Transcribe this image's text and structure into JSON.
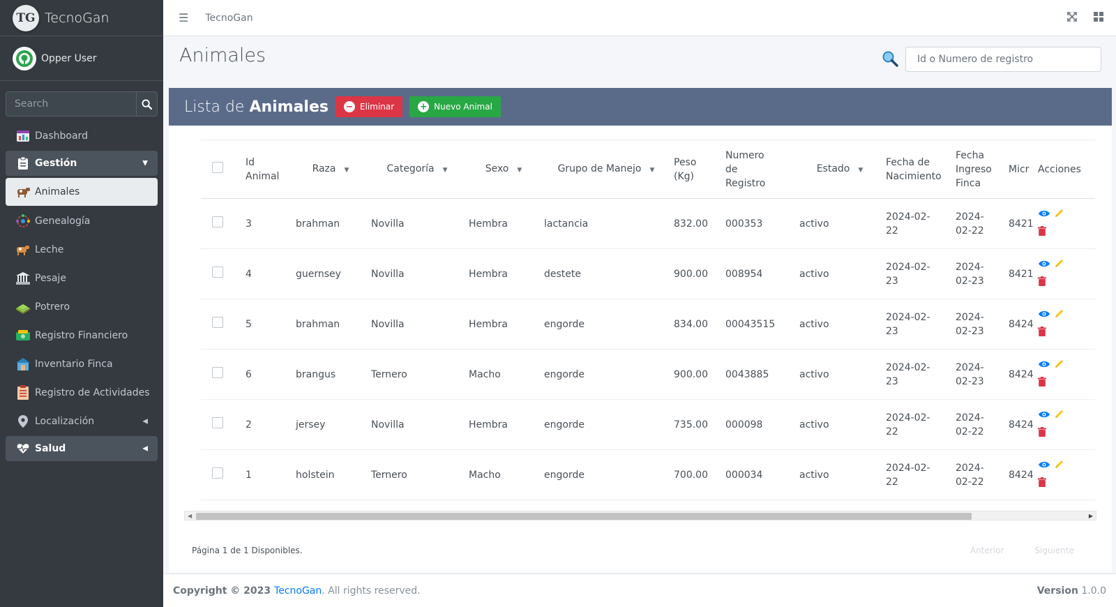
{
  "brand": {
    "logo_text": "TG",
    "name": "TecnoGan"
  },
  "user": {
    "name": "Opper User"
  },
  "sidebar": {
    "search_placeholder": "Search",
    "items": [
      {
        "label": "Dashboard",
        "icon": "dashboard-icon"
      },
      {
        "label": "Gestión",
        "icon": "clipboard-icon"
      },
      {
        "label": "Animales",
        "icon": "cattle-icon"
      },
      {
        "label": "Genealogía",
        "icon": "genealogy-icon"
      },
      {
        "label": "Leche",
        "icon": "milk-icon"
      },
      {
        "label": "Pesaje",
        "icon": "scale-icon"
      },
      {
        "label": "Potrero",
        "icon": "pasture-icon"
      },
      {
        "label": "Registro Financiero",
        "icon": "money-icon"
      },
      {
        "label": "Inventario Finca",
        "icon": "warehouse-icon"
      },
      {
        "label": "Registro de Actividades",
        "icon": "activity-list-icon"
      },
      {
        "label": "Localización",
        "icon": "map-marker-icon"
      },
      {
        "label": "Salud",
        "icon": "heartbeat-icon"
      }
    ]
  },
  "topbar": {
    "title": "TecnoGan"
  },
  "page": {
    "title": "Animales",
    "search_placeholder": "Id o Numero de registro"
  },
  "card": {
    "title_prefix": "Lista de ",
    "title_bold": "Animales",
    "delete_label": "Eliminar",
    "new_label": "Nuevo Animal"
  },
  "table": {
    "headers": {
      "id": "Id Animal",
      "raza": "Raza",
      "categoria": "Categoría",
      "sexo": "Sexo",
      "grupo": "Grupo de Manejo",
      "peso": "Peso (Kg)",
      "numero": "Numero de Registro",
      "estado": "Estado",
      "fecha_nac": "Fecha de Nacimiento",
      "fecha_ingreso": "Fecha Ingreso Finca",
      "micro": "Micr",
      "acciones": "Acciones"
    },
    "rows": [
      {
        "id": "3",
        "raza": "brahman",
        "categoria": "Novilla",
        "sexo": "Hembra",
        "grupo": "lactancia",
        "peso": "832.00",
        "numero": "000353",
        "estado": "activo",
        "fecha_nac_1": "2024-02-",
        "fecha_nac_2": "22",
        "fecha_ing_1": "2024-",
        "fecha_ing_2": "02-22",
        "micro": "8421"
      },
      {
        "id": "4",
        "raza": "guernsey",
        "categoria": "Novilla",
        "sexo": "Hembra",
        "grupo": "destete",
        "peso": "900.00",
        "numero": "008954",
        "estado": "activo",
        "fecha_nac_1": "2024-02-",
        "fecha_nac_2": "23",
        "fecha_ing_1": "2024-",
        "fecha_ing_2": "02-23",
        "micro": "8421"
      },
      {
        "id": "5",
        "raza": "brahman",
        "categoria": "Novilla",
        "sexo": "Hembra",
        "grupo": "engorde",
        "peso": "834.00",
        "numero": "00043515",
        "estado": "activo",
        "fecha_nac_1": "2024-02-",
        "fecha_nac_2": "23",
        "fecha_ing_1": "2024-",
        "fecha_ing_2": "02-23",
        "micro": "8424"
      },
      {
        "id": "6",
        "raza": "brangus",
        "categoria": "Ternero",
        "sexo": "Macho",
        "grupo": "engorde",
        "peso": "900.00",
        "numero": "0043885",
        "estado": "activo",
        "fecha_nac_1": "2024-02-",
        "fecha_nac_2": "23",
        "fecha_ing_1": "2024-",
        "fecha_ing_2": "02-23",
        "micro": "8424"
      },
      {
        "id": "2",
        "raza": "jersey",
        "categoria": "Novilla",
        "sexo": "Hembra",
        "grupo": "engorde",
        "peso": "735.00",
        "numero": "000098",
        "estado": "activo",
        "fecha_nac_1": "2024-02-",
        "fecha_nac_2": "22",
        "fecha_ing_1": "2024-",
        "fecha_ing_2": "02-22",
        "micro": "8424"
      },
      {
        "id": "1",
        "raza": "holstein",
        "categoria": "Ternero",
        "sexo": "Macho",
        "grupo": "engorde",
        "peso": "700.00",
        "numero": "000034",
        "estado": "activo",
        "fecha_nac_1": "2024-02-",
        "fecha_nac_2": "22",
        "fecha_ing_1": "2024-",
        "fecha_ing_2": "02-22",
        "micro": "8424"
      }
    ]
  },
  "pagination": {
    "info": "Página 1 de 1 Disponibles.",
    "prev": "Anterior",
    "next": "Siguiente"
  },
  "footer": {
    "copyright": "Copyright © 2023 ",
    "brand": "TecnoGan",
    "rights": ". All rights reserved.",
    "version_label": "Version",
    "version": " 1.0.0"
  },
  "colors": {
    "sidebar_bg": "#343a40",
    "card_header_bg": "#5a6b8a",
    "danger": "#dc3545",
    "success": "#28a745",
    "view_icon": "#007bff",
    "edit_icon": "#ffc107",
    "trash_icon": "#dc3545",
    "link": "#007bff"
  }
}
